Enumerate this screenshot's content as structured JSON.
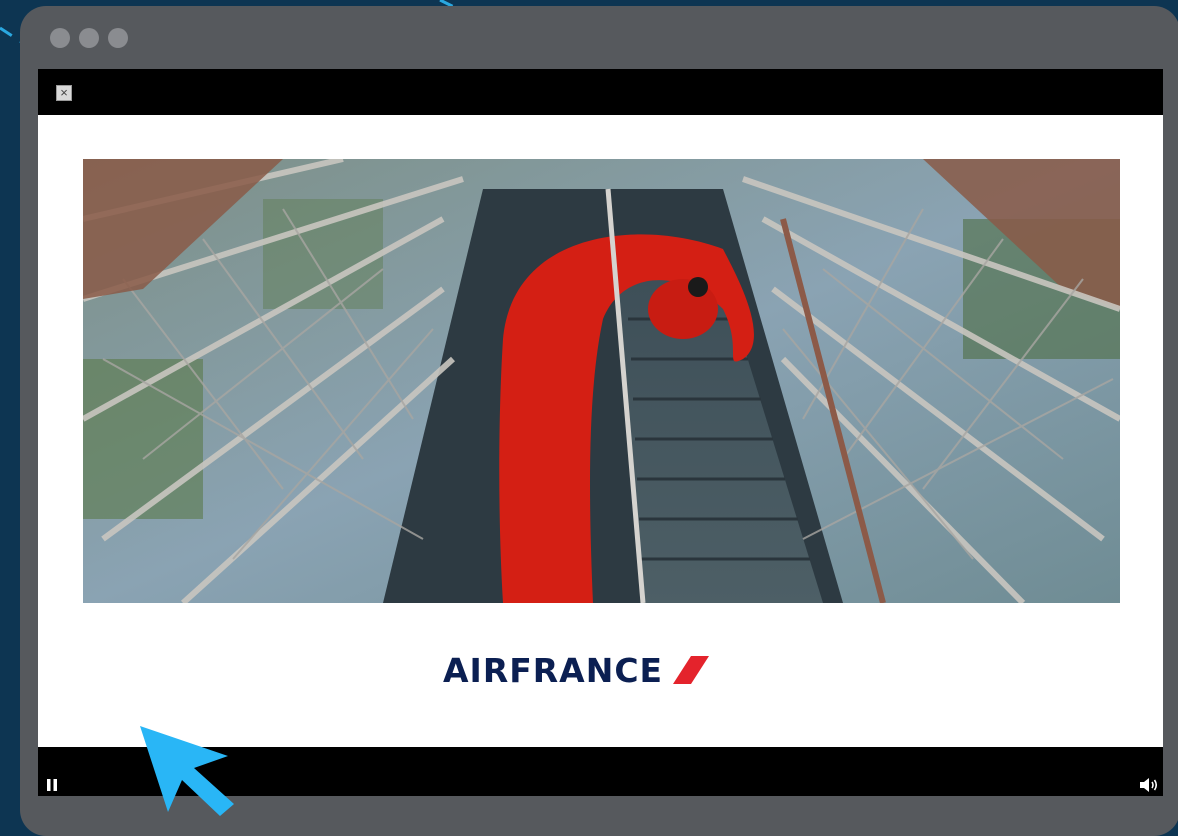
{
  "window": {
    "dot_count": 3
  },
  "player": {
    "close_icon": "close-icon",
    "close_glyph": "×",
    "brand_name": "AIRFRANCE",
    "brand_mark_icon": "airfrance-stripe-icon",
    "controls": {
      "pause_icon": "pause-icon",
      "volume_icon": "volume-icon"
    }
  },
  "colors": {
    "background": "#0d3552",
    "window": "#56595d",
    "accent_line": "#2aa8e0",
    "brand_navy": "#0b1f52",
    "brand_red": "#e4232c",
    "cursor": "#29b6f6"
  }
}
